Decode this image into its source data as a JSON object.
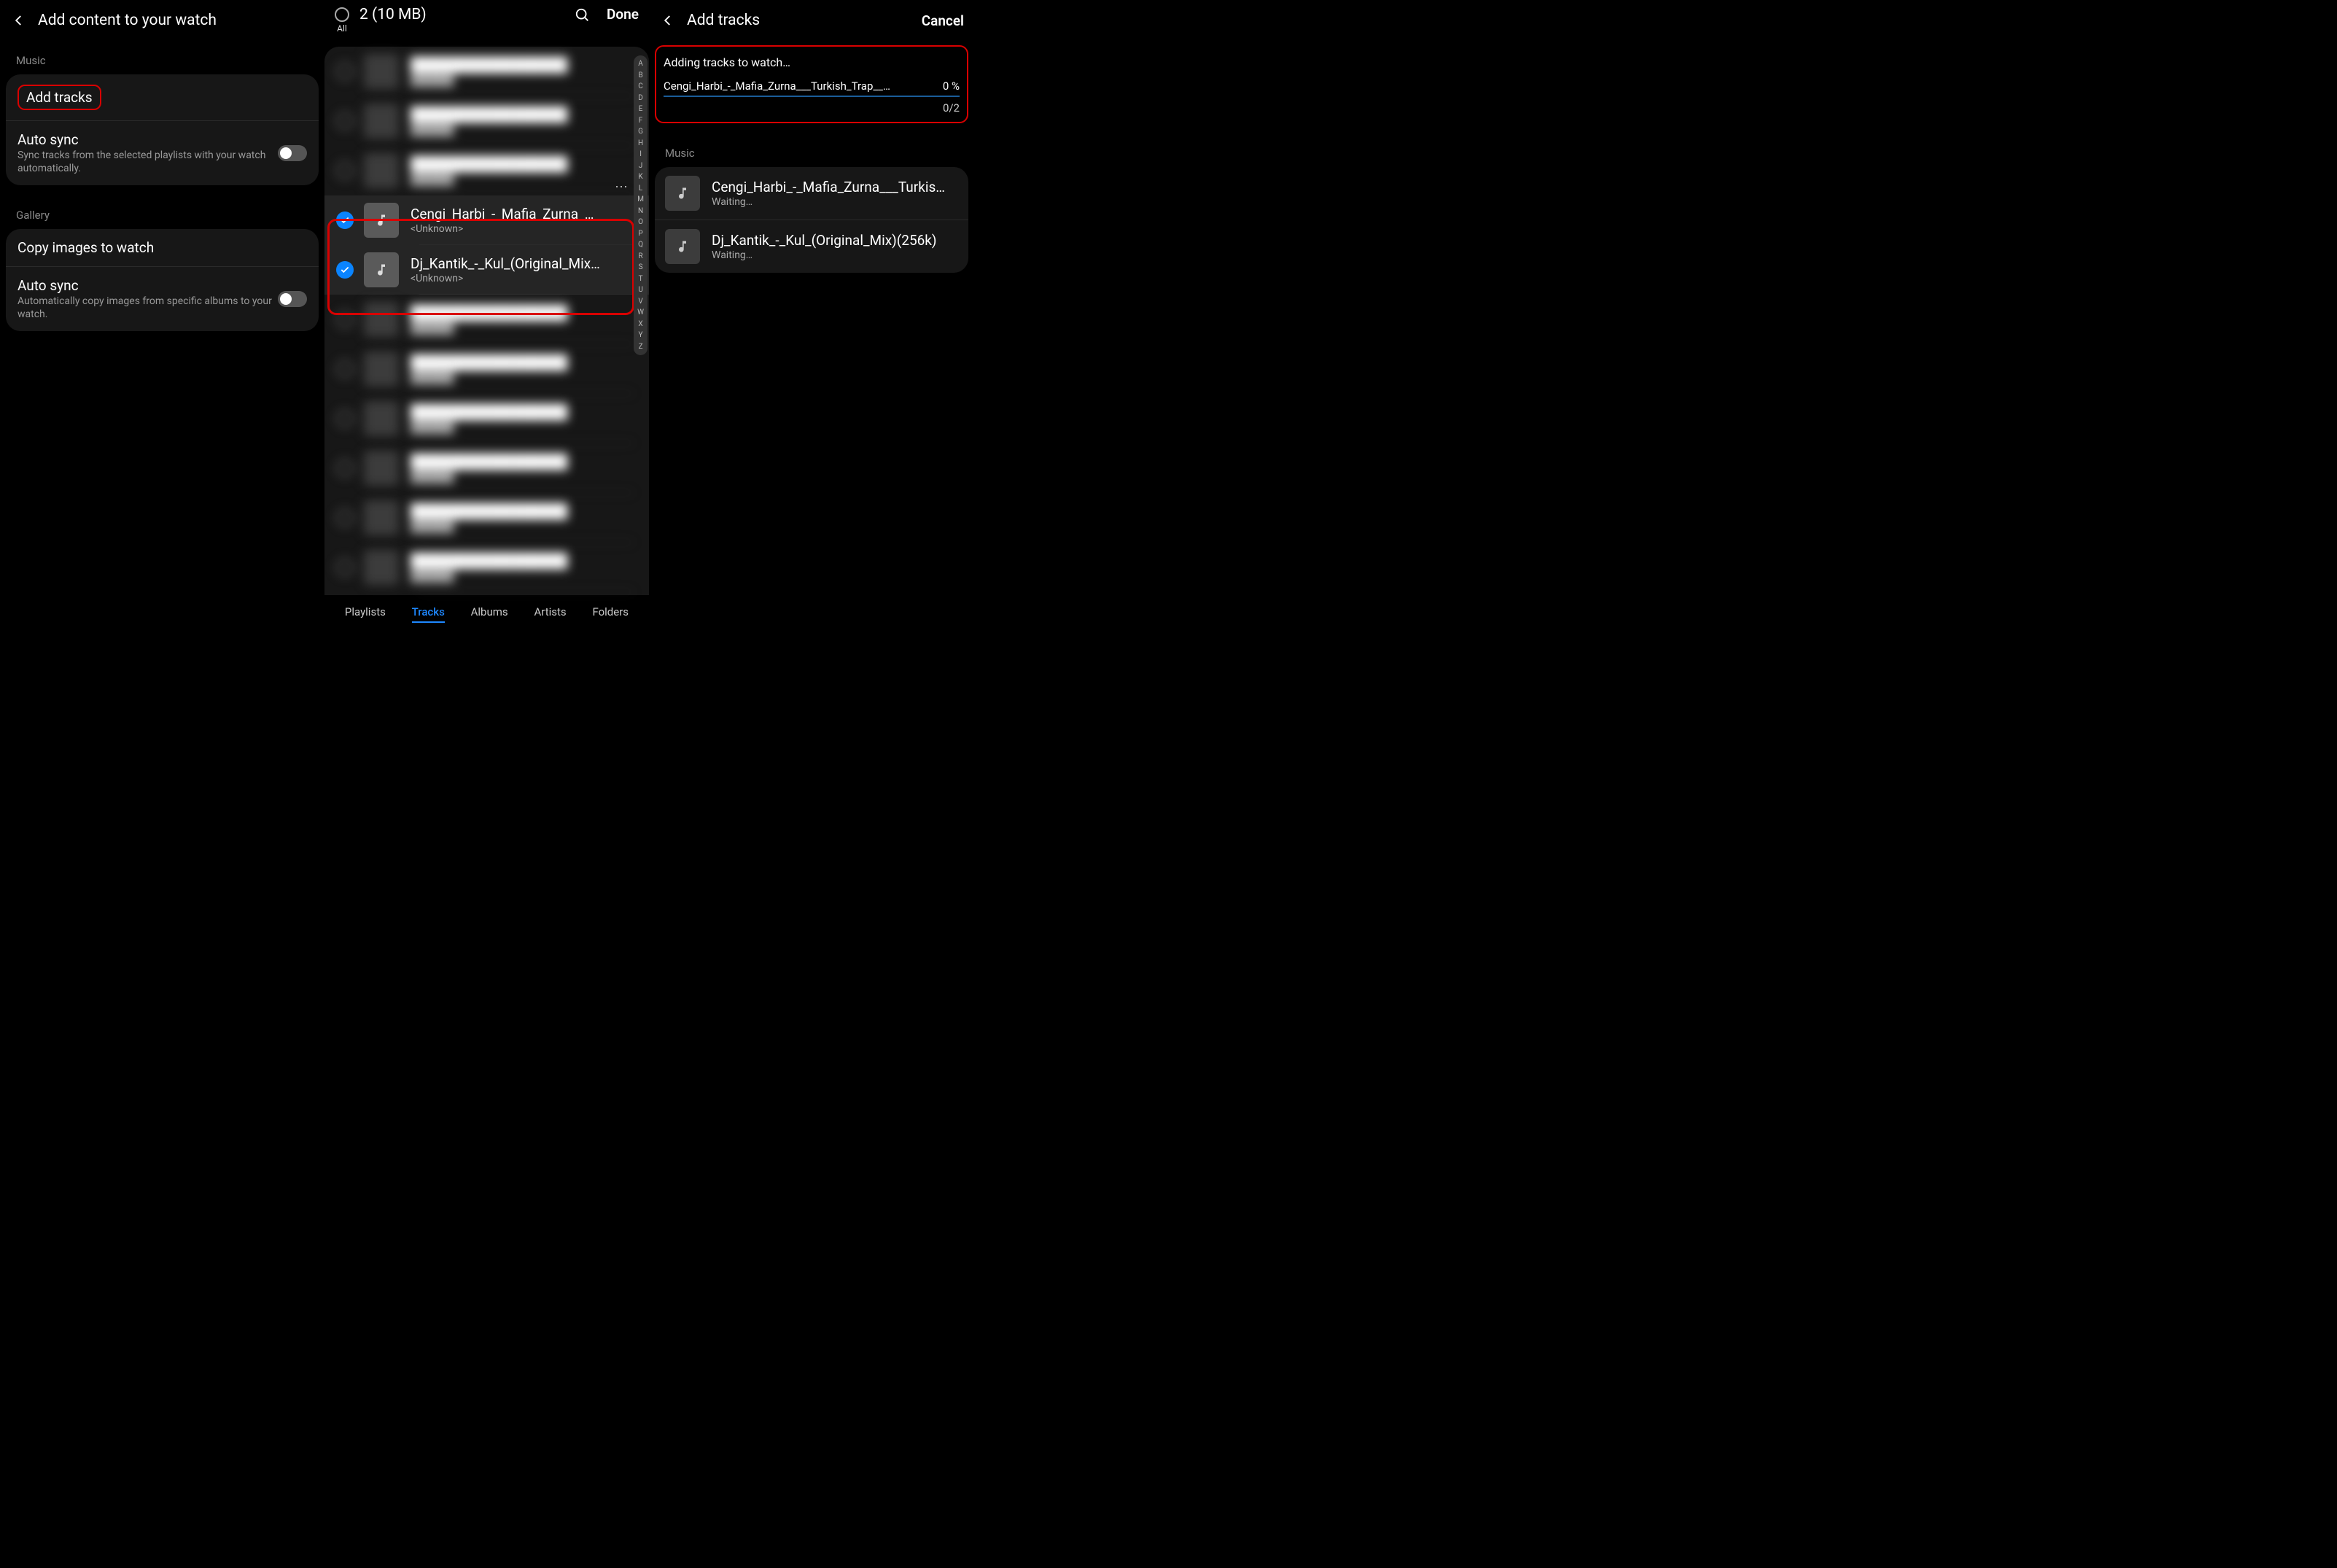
{
  "pane1": {
    "title": "Add content to your watch",
    "music_label": "Music",
    "add_tracks": "Add tracks",
    "auto_sync1_title": "Auto sync",
    "auto_sync1_desc": "Sync tracks from the selected playlists with your watch automatically.",
    "gallery_label": "Gallery",
    "copy_images": "Copy images to watch",
    "auto_sync2_title": "Auto sync",
    "auto_sync2_desc": "Automatically copy images from specific albums to your watch."
  },
  "pane2": {
    "all_label": "All",
    "count": "2 (10 MB)",
    "done": "Done",
    "tracks": [
      {
        "title": "Cengi_Harbi_-_Mafia_Zurna_…",
        "artist": "<Unknown>",
        "selected": true
      },
      {
        "title": "Dj_Kantik_-_Kul_(Original_Mix…",
        "artist": "<Unknown>",
        "selected": true
      }
    ],
    "tabs": [
      "Playlists",
      "Tracks",
      "Albums",
      "Artists",
      "Folders"
    ],
    "alpha": [
      "A",
      "B",
      "C",
      "D",
      "E",
      "F",
      "G",
      "H",
      "I",
      "J",
      "K",
      "L",
      "M",
      "N",
      "O",
      "P",
      "Q",
      "R",
      "S",
      "T",
      "U",
      "V",
      "W",
      "X",
      "Y",
      "Z"
    ]
  },
  "pane3": {
    "title": "Add tracks",
    "cancel": "Cancel",
    "status": "Adding tracks to watch…",
    "current_file": "Cengi_Harbi_-_Mafia_Zurna___Turkish_Trap__…",
    "percent": "0 %",
    "count": "0/2",
    "music_label": "Music",
    "queue": [
      {
        "title": "Cengi_Harbi_-_Mafia_Zurna___Turkis…",
        "status": "Waiting…"
      },
      {
        "title": "Dj_Kantik_-_Kul_(Original_Mix)(256k)",
        "status": "Waiting…"
      }
    ]
  }
}
